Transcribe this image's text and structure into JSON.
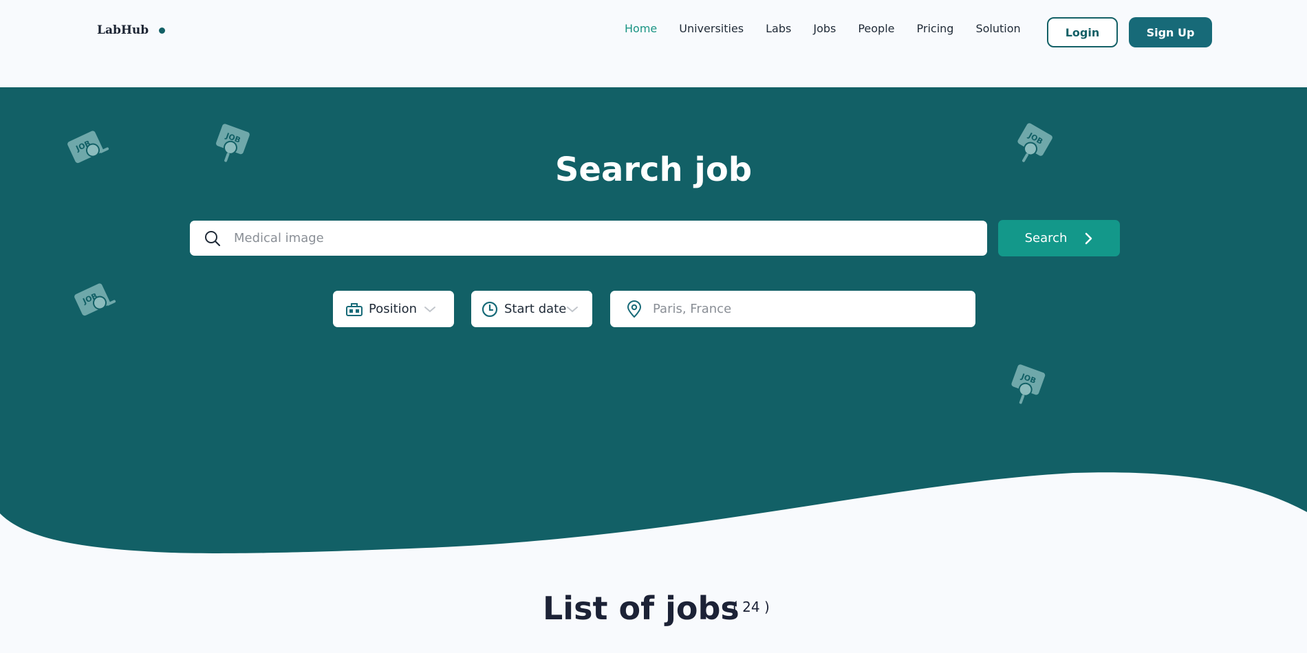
{
  "brand": {
    "name": "LabHub"
  },
  "colors": {
    "primary": "#126066",
    "accent": "#13988a",
    "nav_active": "#1a9484",
    "background": "#f8fafd"
  },
  "nav": {
    "items": [
      {
        "label": "Home",
        "active": true
      },
      {
        "label": "Universities"
      },
      {
        "label": "Labs"
      },
      {
        "label": "Jobs"
      },
      {
        "label": "People"
      },
      {
        "label": "Pricing"
      },
      {
        "label": "Solution"
      }
    ],
    "login_label": "Login",
    "signup_label": "Sign Up"
  },
  "hero": {
    "title": "Search job",
    "search": {
      "placeholder": "Medical image",
      "value": "",
      "icon": "search-icon"
    },
    "search_button": {
      "label": "Search",
      "icon": "chevron-right-icon"
    },
    "filters": {
      "position": {
        "label": "Position",
        "icon": "briefcase-icon"
      },
      "start_date": {
        "label": "Start date",
        "icon": "clock-icon"
      },
      "location": {
        "placeholder": "Paris, France",
        "icon": "map-pin-icon"
      }
    },
    "decorations": {
      "icon": "job-search-icon"
    }
  },
  "list": {
    "title": "List of jobs",
    "count": "( 24 )"
  }
}
